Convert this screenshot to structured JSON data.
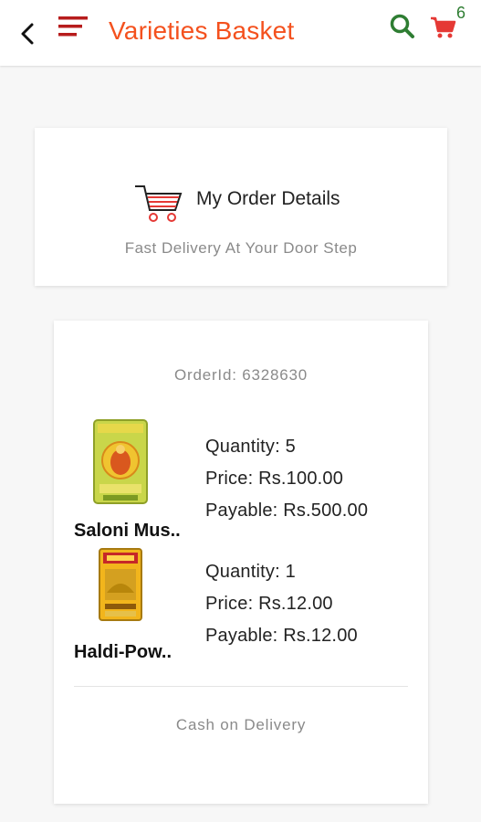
{
  "app": {
    "title": "Varieties Basket",
    "cart_count": "6",
    "colors": {
      "accent": "#f4511e",
      "menu": "#b71c1c",
      "search": "#2e7d32",
      "cart": "#e53935"
    }
  },
  "icons": {
    "back": "chevron-left-icon",
    "menu": "hamburger-menu-icon",
    "search": "search-icon",
    "cart": "shopping-cart-icon"
  },
  "header": {
    "title": "My Order Details",
    "subtitle": "Fast Delivery At Your Door Step"
  },
  "order": {
    "order_id": "OrderId: 6328630",
    "items": [
      {
        "name": "Saloni Mus..",
        "quantity": "Quantity: 5",
        "price": "Price: Rs.100.00",
        "payable": "Payable: Rs.500.00"
      },
      {
        "name": "Haldi-Pow..",
        "quantity": "Quantity: 1",
        "price": "Price: Rs.12.00",
        "payable": "Payable: Rs.12.00"
      }
    ],
    "payment_method": "Cash on Delivery"
  }
}
